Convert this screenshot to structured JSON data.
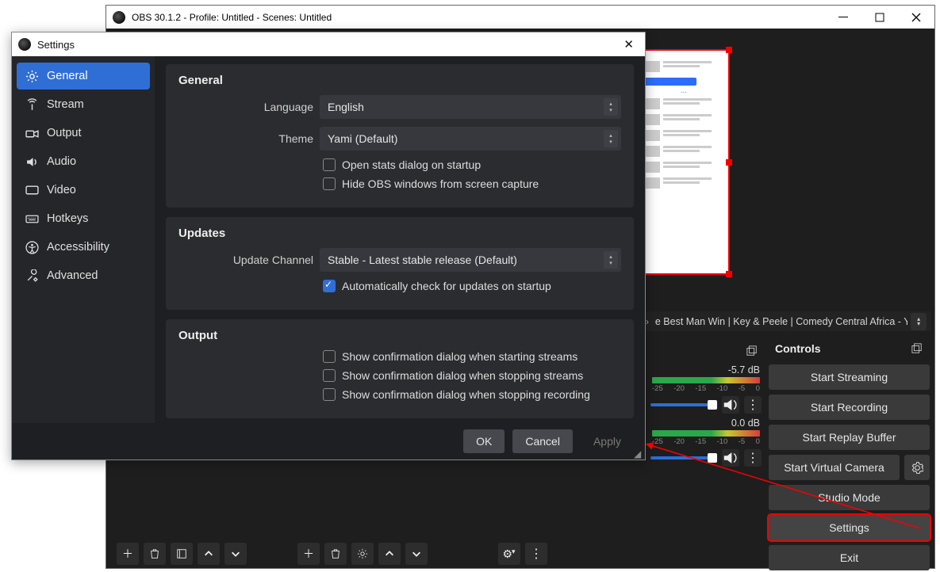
{
  "main_window": {
    "title": "OBS 30.1.2 - Profile: Untitled - Scenes: Untitled",
    "source_title": "e Best Man Win | Key & Peele | Comedy Central Africa - Y"
  },
  "mixer": {
    "ch1_db": "-5.7 dB",
    "ch2_db": "0.0 dB",
    "ticks": [
      "-25",
      "-20",
      "-15",
      "-10",
      "-5",
      "0"
    ]
  },
  "controls": {
    "title": "Controls",
    "start_streaming": "Start Streaming",
    "start_recording": "Start Recording",
    "start_replay_buffer": "Start Replay Buffer",
    "start_virtual_camera": "Start Virtual Camera",
    "studio_mode": "Studio Mode",
    "settings": "Settings",
    "exit": "Exit"
  },
  "settings_dialog": {
    "title": "Settings",
    "nav": {
      "general": "General",
      "stream": "Stream",
      "output": "Output",
      "audio": "Audio",
      "video": "Video",
      "hotkeys": "Hotkeys",
      "accessibility": "Accessibility",
      "advanced": "Advanced"
    },
    "general_section": {
      "heading": "General",
      "language_label": "Language",
      "language_value": "English",
      "theme_label": "Theme",
      "theme_value": "Yami (Default)",
      "open_stats": "Open stats dialog on startup",
      "hide_obs": "Hide OBS windows from screen capture"
    },
    "updates_section": {
      "heading": "Updates",
      "channel_label": "Update Channel",
      "channel_value": "Stable - Latest stable release (Default)",
      "auto_check": "Automatically check for updates on startup"
    },
    "output_section": {
      "heading": "Output",
      "confirm_start_stream": "Show confirmation dialog when starting streams",
      "confirm_stop_stream": "Show confirmation dialog when stopping streams",
      "confirm_stop_record": "Show confirmation dialog when stopping recording"
    },
    "buttons": {
      "ok": "OK",
      "cancel": "Cancel",
      "apply": "Apply"
    }
  }
}
